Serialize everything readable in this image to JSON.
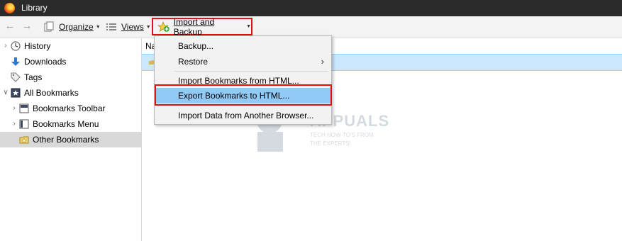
{
  "window": {
    "title": "Library"
  },
  "toolbar": {
    "organize_label": "Organize",
    "views_label": "Views",
    "import_backup_label": "Import and Backup"
  },
  "sidebar": {
    "items": [
      {
        "label": "History"
      },
      {
        "label": "Downloads"
      },
      {
        "label": "Tags"
      },
      {
        "label": "All Bookmarks"
      },
      {
        "label": "Bookmarks Toolbar"
      },
      {
        "label": "Bookmarks Menu"
      },
      {
        "label": "Other Bookmarks"
      }
    ]
  },
  "content": {
    "column_name": "Na"
  },
  "menu": {
    "backup": "Backup...",
    "restore": "Restore",
    "import_html": "Import Bookmarks from HTML...",
    "export_html": "Export Bookmarks to HTML...",
    "import_browser": "Import Data from Another Browser..."
  },
  "watermark": {
    "text": "APPUALS",
    "sub1": "TECH HOW-TO'S FROM",
    "sub2": "THE EXPERTS!"
  },
  "colors": {
    "highlight_border": "#e01010",
    "menu_selected": "#91c9f7",
    "row_selected": "#cce8ff",
    "titlebar": "#2b2b2b"
  }
}
